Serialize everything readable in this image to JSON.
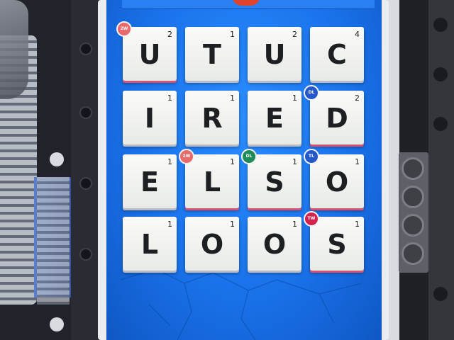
{
  "board": {
    "tiles": [
      {
        "letter": "U",
        "points": "2"
      },
      {
        "letter": "T",
        "points": "1"
      },
      {
        "letter": "U",
        "points": "2"
      },
      {
        "letter": "C",
        "points": "4"
      },
      {
        "letter": "I",
        "points": "1"
      },
      {
        "letter": "R",
        "points": "1"
      },
      {
        "letter": "E",
        "points": "1"
      },
      {
        "letter": "D",
        "points": "2"
      },
      {
        "letter": "E",
        "points": "1"
      },
      {
        "letter": "L",
        "points": "1"
      },
      {
        "letter": "S",
        "points": "1"
      },
      {
        "letter": "O",
        "points": "1"
      },
      {
        "letter": "L",
        "points": "1"
      },
      {
        "letter": "O",
        "points": "1"
      },
      {
        "letter": "O",
        "points": "1"
      },
      {
        "letter": "S",
        "points": "1"
      }
    ],
    "badges": [
      {
        "tile": 0,
        "kind": "multiplier",
        "color": "#e86a6a",
        "label": "2W"
      },
      {
        "tile": 7,
        "kind": "multiplier",
        "color": "#2457c9",
        "label": "DL"
      },
      {
        "tile": 9,
        "kind": "multiplier",
        "color": "#e86a6a",
        "label": "2W"
      },
      {
        "tile": 10,
        "kind": "multiplier",
        "color": "#1f8a5a",
        "label": "DL"
      },
      {
        "tile": 11,
        "kind": "multiplier",
        "color": "#2457c9",
        "label": "TL"
      },
      {
        "tile": 15,
        "kind": "multiplier",
        "color": "#d3224d",
        "label": "TW"
      }
    ]
  },
  "colors": {
    "screen_blue": "#1a72ea",
    "tile_face": "#f6f7f4",
    "letter": "#1e1f22"
  }
}
